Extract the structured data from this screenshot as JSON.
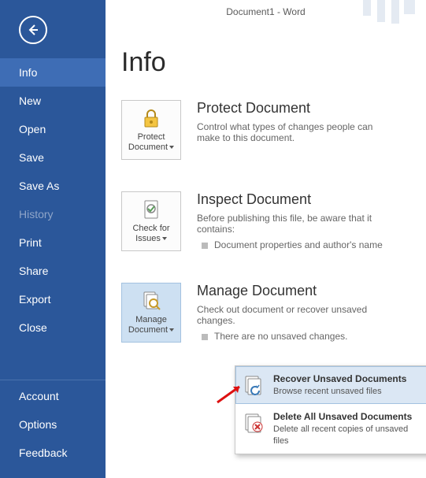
{
  "titlebar": "Document1 - Word",
  "page_title": "Info",
  "sidebar": {
    "items": [
      {
        "label": "Info",
        "active": true
      },
      {
        "label": "New"
      },
      {
        "label": "Open"
      },
      {
        "label": "Save"
      },
      {
        "label": "Save As"
      },
      {
        "label": "History",
        "disabled": true
      },
      {
        "label": "Print"
      },
      {
        "label": "Share"
      },
      {
        "label": "Export"
      },
      {
        "label": "Close"
      }
    ],
    "lower": [
      {
        "label": "Account"
      },
      {
        "label": "Options"
      },
      {
        "label": "Feedback"
      }
    ]
  },
  "sections": {
    "protect": {
      "tile": "Protect Document",
      "title": "Protect Document",
      "desc": "Control what types of changes people can make to this document."
    },
    "inspect": {
      "tile": "Check for Issues",
      "title": "Inspect Document",
      "desc": "Before publishing this file, be aware that it contains:",
      "bullet": "Document properties and author's name"
    },
    "manage": {
      "tile": "Manage Document",
      "title": "Manage Document",
      "desc": "Check out document or recover unsaved changes.",
      "bullet": "There are no unsaved changes."
    }
  },
  "menu": {
    "recover": {
      "title": "Recover Unsaved Documents",
      "desc": "Browse recent unsaved files"
    },
    "delete": {
      "title": "Delete All Unsaved Documents",
      "desc": "Delete all recent copies of unsaved files"
    }
  }
}
